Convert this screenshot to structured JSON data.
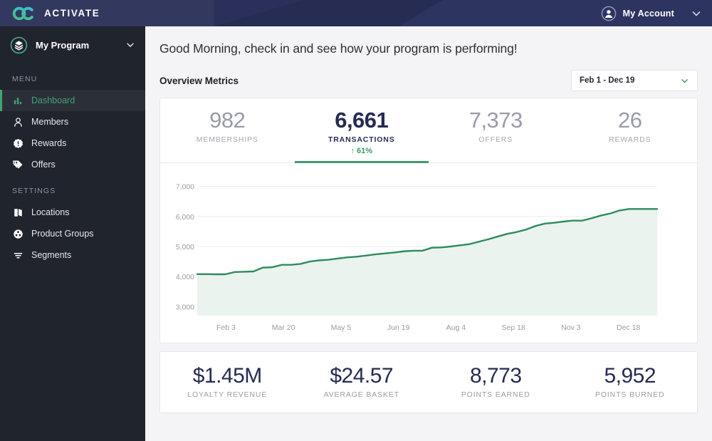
{
  "topbar": {
    "brand_name": "ACTIVATE",
    "logo_icon": "oc-logo-icon",
    "account_label": "My Account",
    "account_icon": "user-circle-icon",
    "caret_icon": "chevron-down-icon",
    "background": "#2a3059"
  },
  "sidebar": {
    "program_label": "My Program",
    "program_icon": "layers-circle-icon",
    "program_caret_icon": "chevron-down-icon",
    "sections": [
      {
        "title": "MENU",
        "items": [
          {
            "label": "Dashboard",
            "icon": "bar-chart-icon",
            "active": true
          },
          {
            "label": "Members",
            "icon": "person-icon",
            "active": false
          },
          {
            "label": "Rewards",
            "icon": "badge-seal-icon",
            "active": false
          },
          {
            "label": "Offers",
            "icon": "tag-icon",
            "active": false
          }
        ]
      },
      {
        "title": "SETTINGS",
        "items": [
          {
            "label": "Locations",
            "icon": "book-map-icon",
            "active": false
          },
          {
            "label": "Product Groups",
            "icon": "product-circles-icon",
            "active": false
          },
          {
            "label": "Segments",
            "icon": "filter-lines-icon",
            "active": false
          }
        ]
      }
    ],
    "active_color": "#43a271",
    "background": "#20242c"
  },
  "main": {
    "greeting": "Good Morning, check in and see how your program is performing!",
    "section_title": "Overview Metrics",
    "daterange": {
      "label": "Feb 1 - Dec 19",
      "caret_icon": "chevron-down-icon"
    },
    "kpis": [
      {
        "value": "982",
        "label": "MEMBERSHIPS",
        "active": false,
        "delta": ""
      },
      {
        "value": "6,661",
        "label": "TRANSACTIONS",
        "active": true,
        "delta": "↑ 61%"
      },
      {
        "value": "7,373",
        "label": "OFFERS",
        "active": false,
        "delta": ""
      },
      {
        "value": "26",
        "label": "REWARDS",
        "active": false,
        "delta": ""
      }
    ],
    "bottom_kpis": [
      {
        "value": "$1.45M",
        "label": "LOYALTY REVENUE"
      },
      {
        "value": "$24.57",
        "label": "AVERAGE BASKET"
      },
      {
        "value": "8,773",
        "label": "POINTS EARNED"
      },
      {
        "value": "5,952",
        "label": "POINTS BURNED"
      }
    ]
  },
  "chart_data": {
    "type": "area",
    "title": "",
    "xlabel": "",
    "ylabel": "",
    "series_name": "Transactions",
    "line_color": "#2e8b5e",
    "fill_color": "#eaf3ee",
    "grid": true,
    "legend": "none",
    "ylim": [
      2700,
      7300
    ],
    "yticks": [
      3000,
      4000,
      5000,
      6000,
      7000
    ],
    "ytick_labels": [
      "3,000",
      "4,000",
      "5,000",
      "6,000",
      "7,000"
    ],
    "xticks": [
      "Feb 3",
      "Mar 20",
      "May 5",
      "Jun 19",
      "Aug 4",
      "Sep 18",
      "Nov 3",
      "Dec 18"
    ],
    "x": [
      0,
      1,
      2,
      3,
      4,
      5,
      6,
      7,
      8,
      9,
      10,
      11,
      12,
      13,
      14,
      15,
      16,
      17,
      18,
      19,
      20,
      21,
      22,
      23,
      24,
      25,
      26,
      27,
      28,
      29,
      30,
      31,
      32,
      33,
      34,
      35,
      36,
      37,
      38,
      39,
      40,
      41,
      42,
      43,
      44,
      45,
      46,
      47,
      48,
      49
    ],
    "values": [
      4080,
      4080,
      4075,
      4075,
      4150,
      4160,
      4170,
      4300,
      4310,
      4390,
      4390,
      4420,
      4500,
      4540,
      4560,
      4600,
      4640,
      4660,
      4700,
      4740,
      4770,
      4800,
      4840,
      4860,
      4860,
      4960,
      4970,
      5000,
      5040,
      5080,
      5160,
      5240,
      5330,
      5420,
      5480,
      5560,
      5680,
      5760,
      5790,
      5830,
      5860,
      5860,
      5940,
      6030,
      6100,
      6200,
      6250,
      6250,
      6250,
      6250
    ]
  }
}
